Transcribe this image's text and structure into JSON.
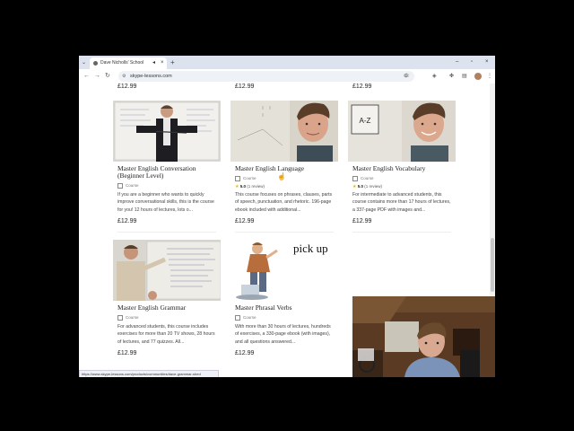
{
  "browser": {
    "tab_title": "Dave Nicholls' School",
    "url": "skype-lessons.com",
    "status_url": "https://www.skype-lessons.com/products/communities/dave-grammar-shed"
  },
  "top_prices": [
    "£12.99",
    "£12.99",
    "£12.99"
  ],
  "courses": [
    {
      "title": "Master English Conversation (Beginner Level)",
      "type": "Course",
      "rating": null,
      "reviews": null,
      "description": "If you are a beginner who wants to quickly improve conversational skills, this is the course for you! 12 hours of lectures, lots o...",
      "price": "£12.99"
    },
    {
      "title": "Master English Language",
      "type": "Course",
      "rating": "5.0",
      "reviews": "(1 review)",
      "description": "This course focuses on phrases, clauses, parts of speech, punctuation, and rhetoric. 196-page ebook included with additional...",
      "price": "£12.99"
    },
    {
      "title": "Master English Vocabulary",
      "type": "Course",
      "rating": "5.0",
      "reviews": "(1 review)",
      "description": "For intermediate to advanced students, this course contains more than 17 hours of lectures, a 337-page PDF with images and...",
      "price": "£12.99"
    },
    {
      "title": "Master English Grammar",
      "type": "Course",
      "rating": null,
      "reviews": null,
      "description": "For advanced students, this course includes exercises for more than 20 TV shows, 28 hours of lectures, and 77 quizzes. All...",
      "price": "£12.99"
    },
    {
      "title": "Master Phrasal Verbs",
      "type": "Course",
      "rating": null,
      "reviews": null,
      "description": "With more than 30 hours of lectures, hundreds of exercises, a 330-page ebook (with images), and all questions answered...",
      "price": "£12.99"
    }
  ],
  "thumb_text": {
    "vocab_card": "A-Z",
    "phrasal": "pick up"
  },
  "colors": {
    "star": "#e6b800",
    "tabbar": "#dde3ee"
  }
}
